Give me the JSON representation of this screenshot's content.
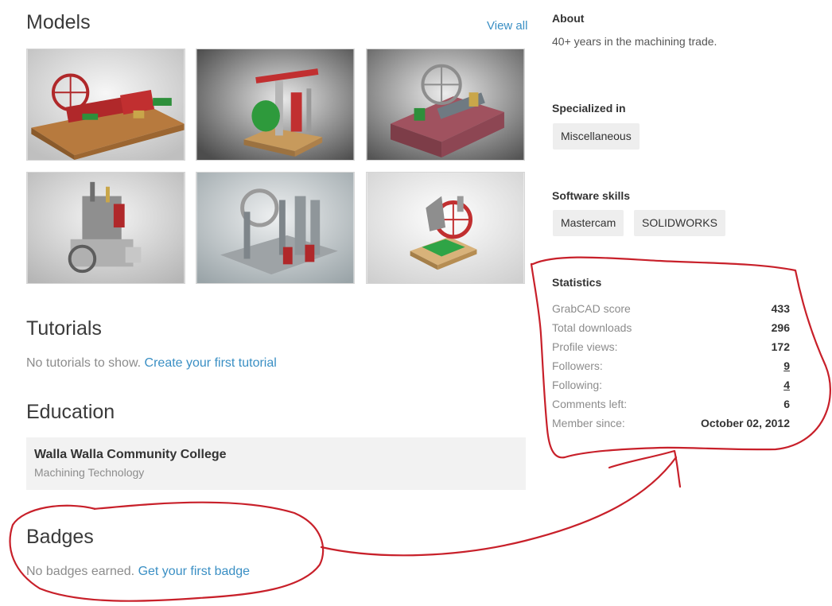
{
  "models": {
    "title": "Models",
    "view_all": "View all"
  },
  "tutorials": {
    "title": "Tutorials",
    "empty_text": "No tutorials to show.",
    "cta": "Create your first tutorial"
  },
  "education": {
    "title": "Education",
    "school": "Walla Walla Community College",
    "program": "Machining Technology"
  },
  "badges": {
    "title": "Badges",
    "empty_text": "No badges earned.",
    "cta": "Get your first badge"
  },
  "about": {
    "title": "About",
    "text": "40+ years in the machining trade."
  },
  "specialized": {
    "title": "Specialized in",
    "tags": [
      "Miscellaneous"
    ]
  },
  "software": {
    "title": "Software skills",
    "tags": [
      "Mastercam",
      "SOLIDWORKS"
    ]
  },
  "statistics": {
    "title": "Statistics",
    "rows": [
      {
        "label": "GrabCAD score",
        "value": "433"
      },
      {
        "label": "Total downloads",
        "value": "296"
      },
      {
        "label": "Profile views:",
        "value": "172"
      },
      {
        "label": "Followers:",
        "value": "9"
      },
      {
        "label": "Following:",
        "value": "4"
      },
      {
        "label": "Comments left:",
        "value": "6"
      },
      {
        "label": "Member since:",
        "value": "October 02, 2012"
      }
    ]
  },
  "colors": {
    "link": "#3a8fc4",
    "annotation": "#c8202a",
    "card_bg": "#f2f2f2",
    "tag_bg": "#eeeeee"
  }
}
